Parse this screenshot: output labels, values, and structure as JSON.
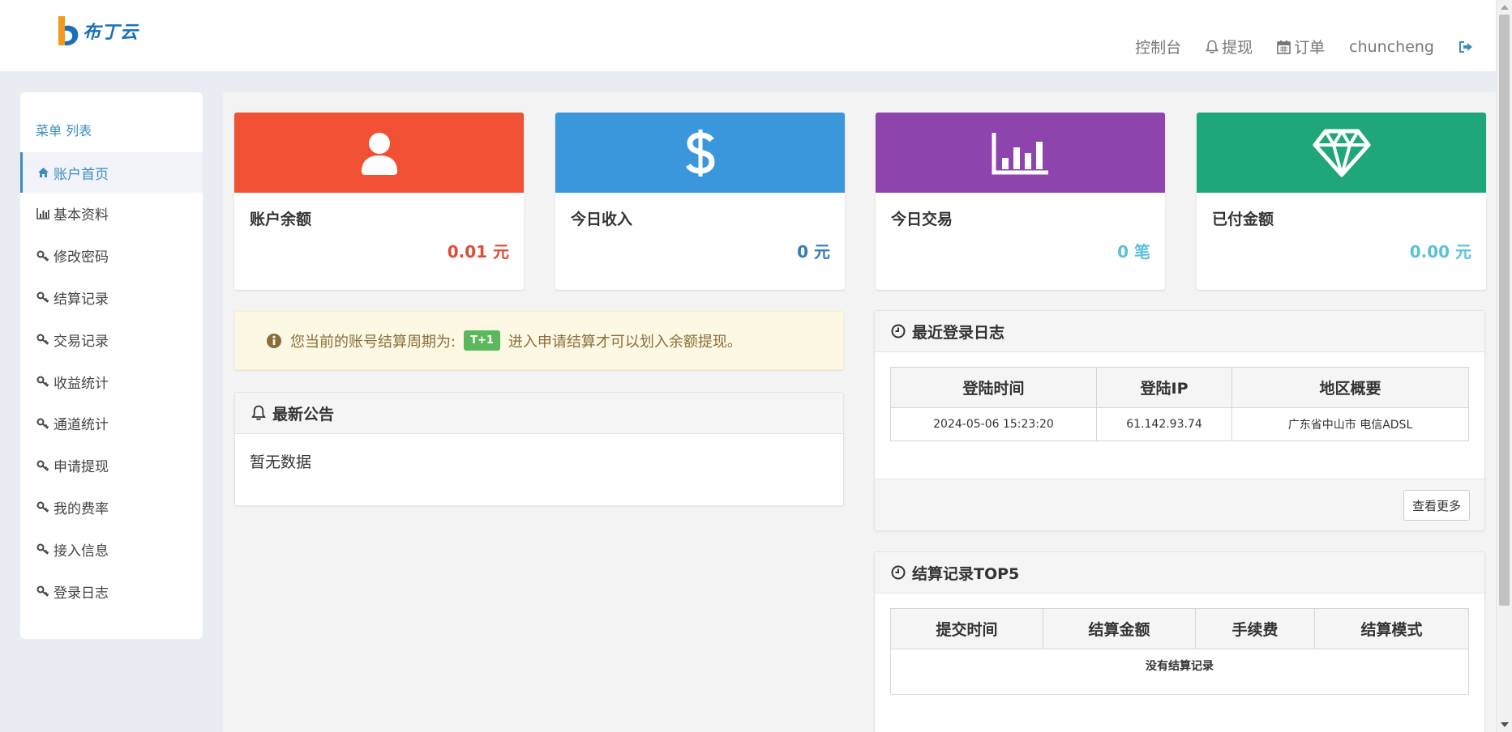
{
  "header": {
    "logo_text": "布丁云",
    "nav": {
      "console": "控制台",
      "withdraw": "提现",
      "orders": "订单",
      "username": "chuncheng"
    }
  },
  "sidebar": {
    "title": "菜单 列表",
    "items": [
      {
        "label": "账户首页",
        "icon": "home-icon",
        "active": true
      },
      {
        "label": "基本资料",
        "icon": "bar-chart-icon"
      },
      {
        "label": "修改密码",
        "icon": "key-icon"
      },
      {
        "label": "结算记录",
        "icon": "key-icon"
      },
      {
        "label": "交易记录",
        "icon": "key-icon"
      },
      {
        "label": "收益统计",
        "icon": "key-icon"
      },
      {
        "label": "通道统计",
        "icon": "key-icon"
      },
      {
        "label": "申请提现",
        "icon": "key-icon"
      },
      {
        "label": "我的费率",
        "icon": "key-icon"
      },
      {
        "label": "接入信息",
        "icon": "key-icon"
      },
      {
        "label": "登录日志",
        "icon": "key-icon"
      }
    ]
  },
  "stats": [
    {
      "label": "账户余额",
      "value": "0.01 元",
      "icon": "user-icon",
      "color": "#f05033",
      "value_color": "#dd4b39"
    },
    {
      "label": "今日收入",
      "value": "0 元",
      "icon": "dollar-icon",
      "color": "#3a97dc",
      "value_color": "#337ab7"
    },
    {
      "label": "今日交易",
      "value": "0 笔",
      "icon": "bar-chart-icon",
      "color": "#8e44ad",
      "value_color": "#5bc0de"
    },
    {
      "label": "已付金额",
      "value": "0.00 元",
      "icon": "diamond-icon",
      "color": "#1fa67a",
      "value_color": "#5bc0de"
    }
  ],
  "alert": {
    "prefix": "您当前的账号结算周期为:",
    "badge": "T+1",
    "suffix": "进入申请结算才可以划入余额提现。"
  },
  "notice": {
    "title": "最新公告",
    "empty": "暂无数据"
  },
  "login_log": {
    "title": "最近登录日志",
    "columns": [
      "登陆时间",
      "登陆IP",
      "地区概要"
    ],
    "rows": [
      [
        "2024-05-06 15:23:20",
        "61.142.93.74",
        "广东省中山市 电信ADSL"
      ]
    ],
    "more_label": "查看更多"
  },
  "settlement": {
    "title": "结算记录TOP5",
    "columns": [
      "提交时间",
      "结算金额",
      "手续费",
      "结算模式"
    ],
    "empty": "没有结算记录"
  }
}
